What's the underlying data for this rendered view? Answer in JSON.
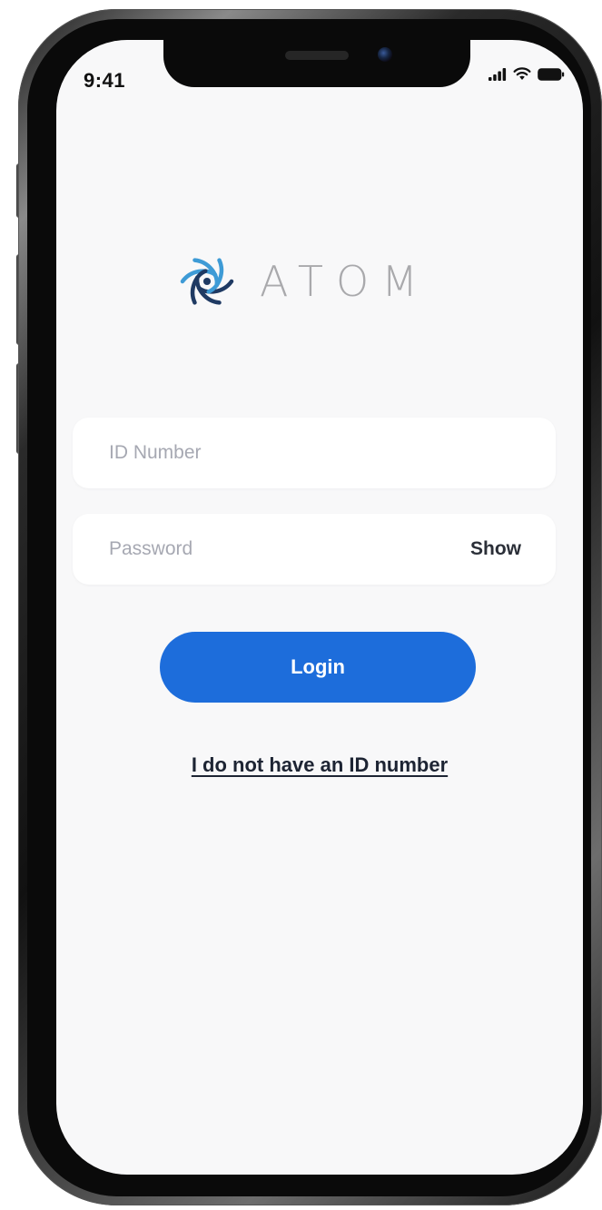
{
  "status_bar": {
    "time": "9:41",
    "icons": [
      "signal-icon",
      "wifi-icon",
      "battery-icon"
    ]
  },
  "brand": {
    "name": "ATOM",
    "logo_icon": "atom-logo-icon",
    "colors": {
      "mark_blue": "#3e9bd6",
      "mark_navy": "#1f3a63",
      "wordmark": "#a9a9ac"
    }
  },
  "form": {
    "id_field": {
      "placeholder": "ID Number",
      "value": ""
    },
    "password_field": {
      "placeholder": "Password",
      "value": "",
      "toggle_label": "Show"
    }
  },
  "actions": {
    "login_label": "Login",
    "no_id_link": "I do not have an ID number"
  },
  "theme": {
    "primary": "#1d6ddb",
    "background": "#f8f8f9",
    "field_background": "#ffffff",
    "placeholder": "#a6a8b2",
    "text_dark": "#1d2433"
  }
}
